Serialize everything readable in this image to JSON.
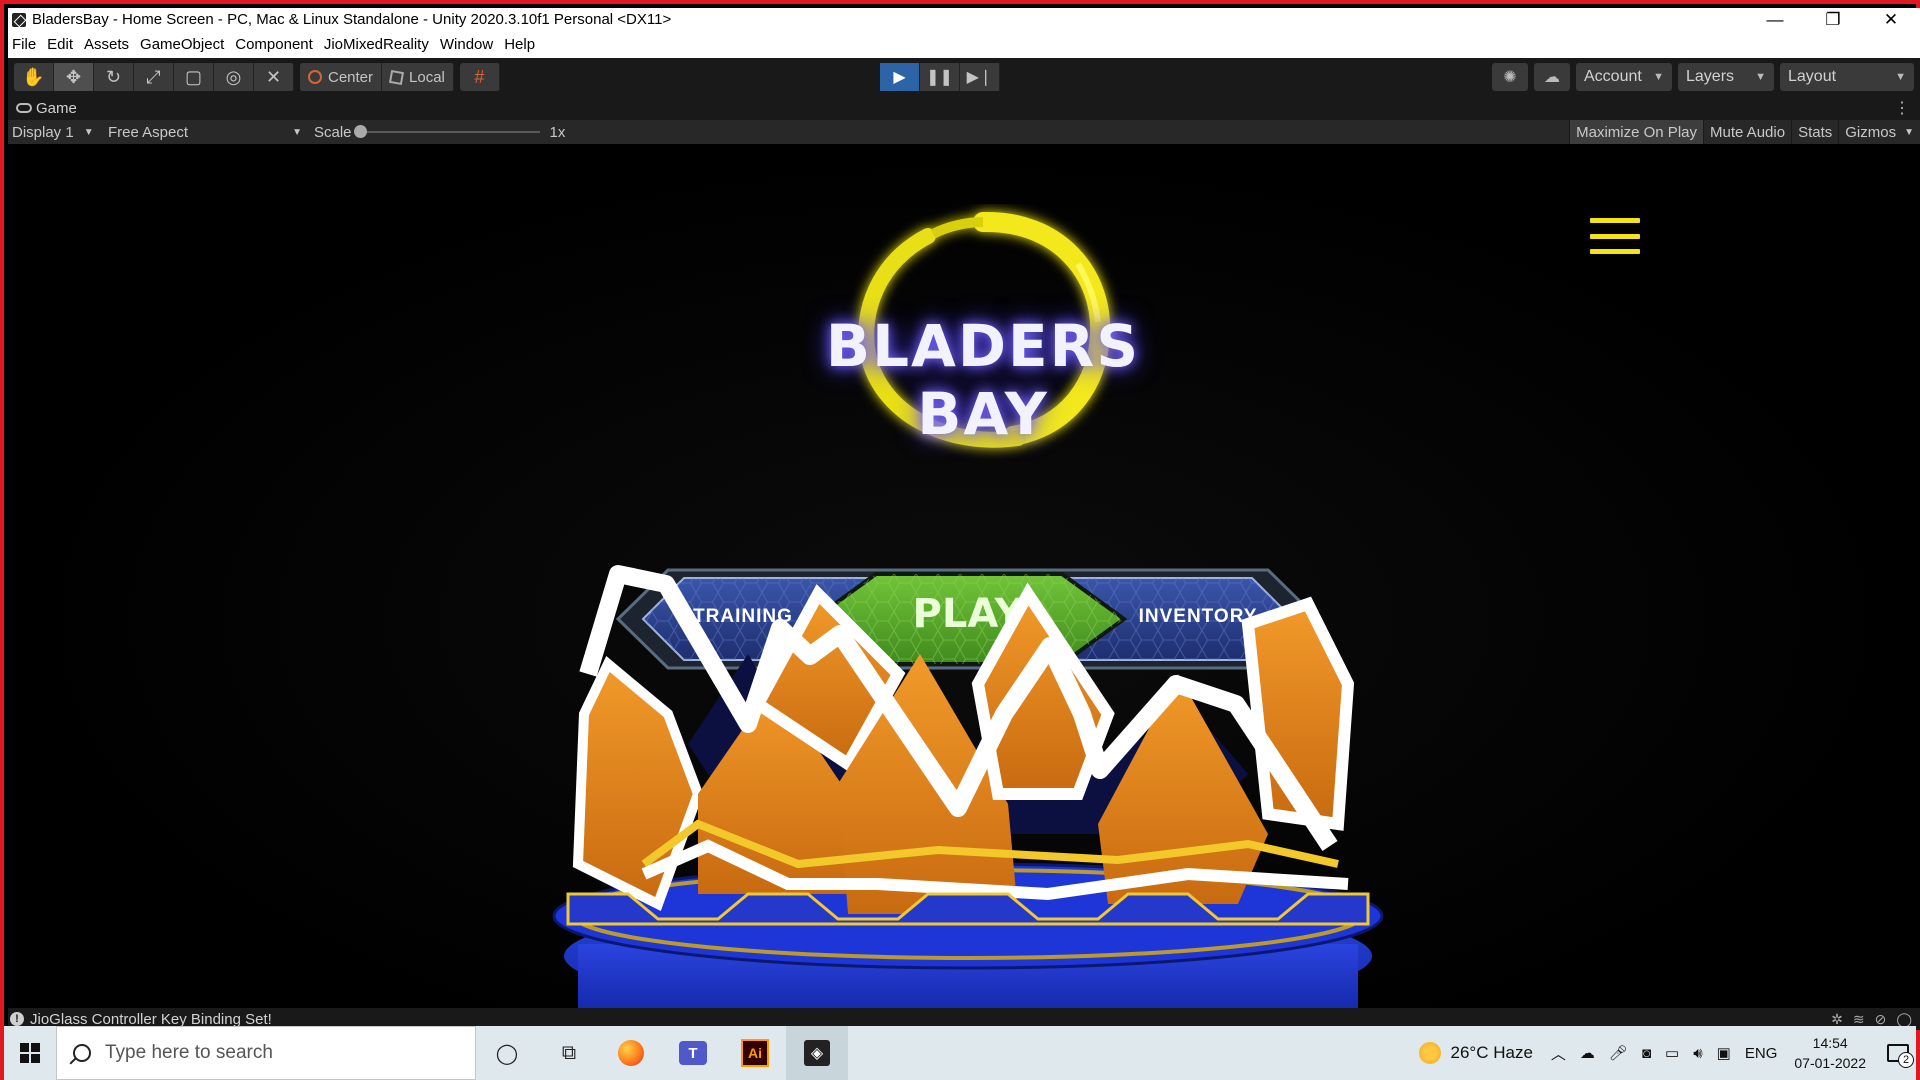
{
  "window": {
    "title": "BladersBay - Home Screen - PC, Mac & Linux Standalone - Unity 2020.3.10f1 Personal <DX11>",
    "controls": {
      "minimize": "—",
      "restore": "❐",
      "close": "✕"
    }
  },
  "menu": [
    "File",
    "Edit",
    "Assets",
    "GameObject",
    "Component",
    "JioMixedReality",
    "Window",
    "Help"
  ],
  "toolbar": {
    "pivot_label": "Center",
    "space_label": "Local",
    "account_label": "Account",
    "layers_label": "Layers",
    "layout_label": "Layout"
  },
  "game_tab": {
    "label": "Game"
  },
  "game_controls": {
    "display": "Display 1",
    "aspect": "Free Aspect",
    "scale_label": "Scale",
    "scale_value": "1x",
    "options": [
      "Maximize On Play",
      "Mute Audio",
      "Stats",
      "Gizmos"
    ]
  },
  "game": {
    "logo_text": "BLADERS BAY",
    "buttons": {
      "training": "TRAINING",
      "play": "PLAY",
      "inventory": "INVENTORY"
    },
    "colors": {
      "logo_ring": "#f2e81a",
      "play_green": "#5caa2c",
      "side_blue": "#2b3f8a",
      "arena_orange": "#e8871e",
      "arena_blue": "#1c33c8",
      "menu_icon": "#f6e414"
    }
  },
  "status": {
    "message": "JioGlass Controller Key Binding Set!"
  },
  "taskbar": {
    "search_placeholder": "Type here to search",
    "weather": "26°C  Haze",
    "language": "ENG",
    "time": "14:54",
    "date": "07-01-2022",
    "notifications": "2"
  }
}
